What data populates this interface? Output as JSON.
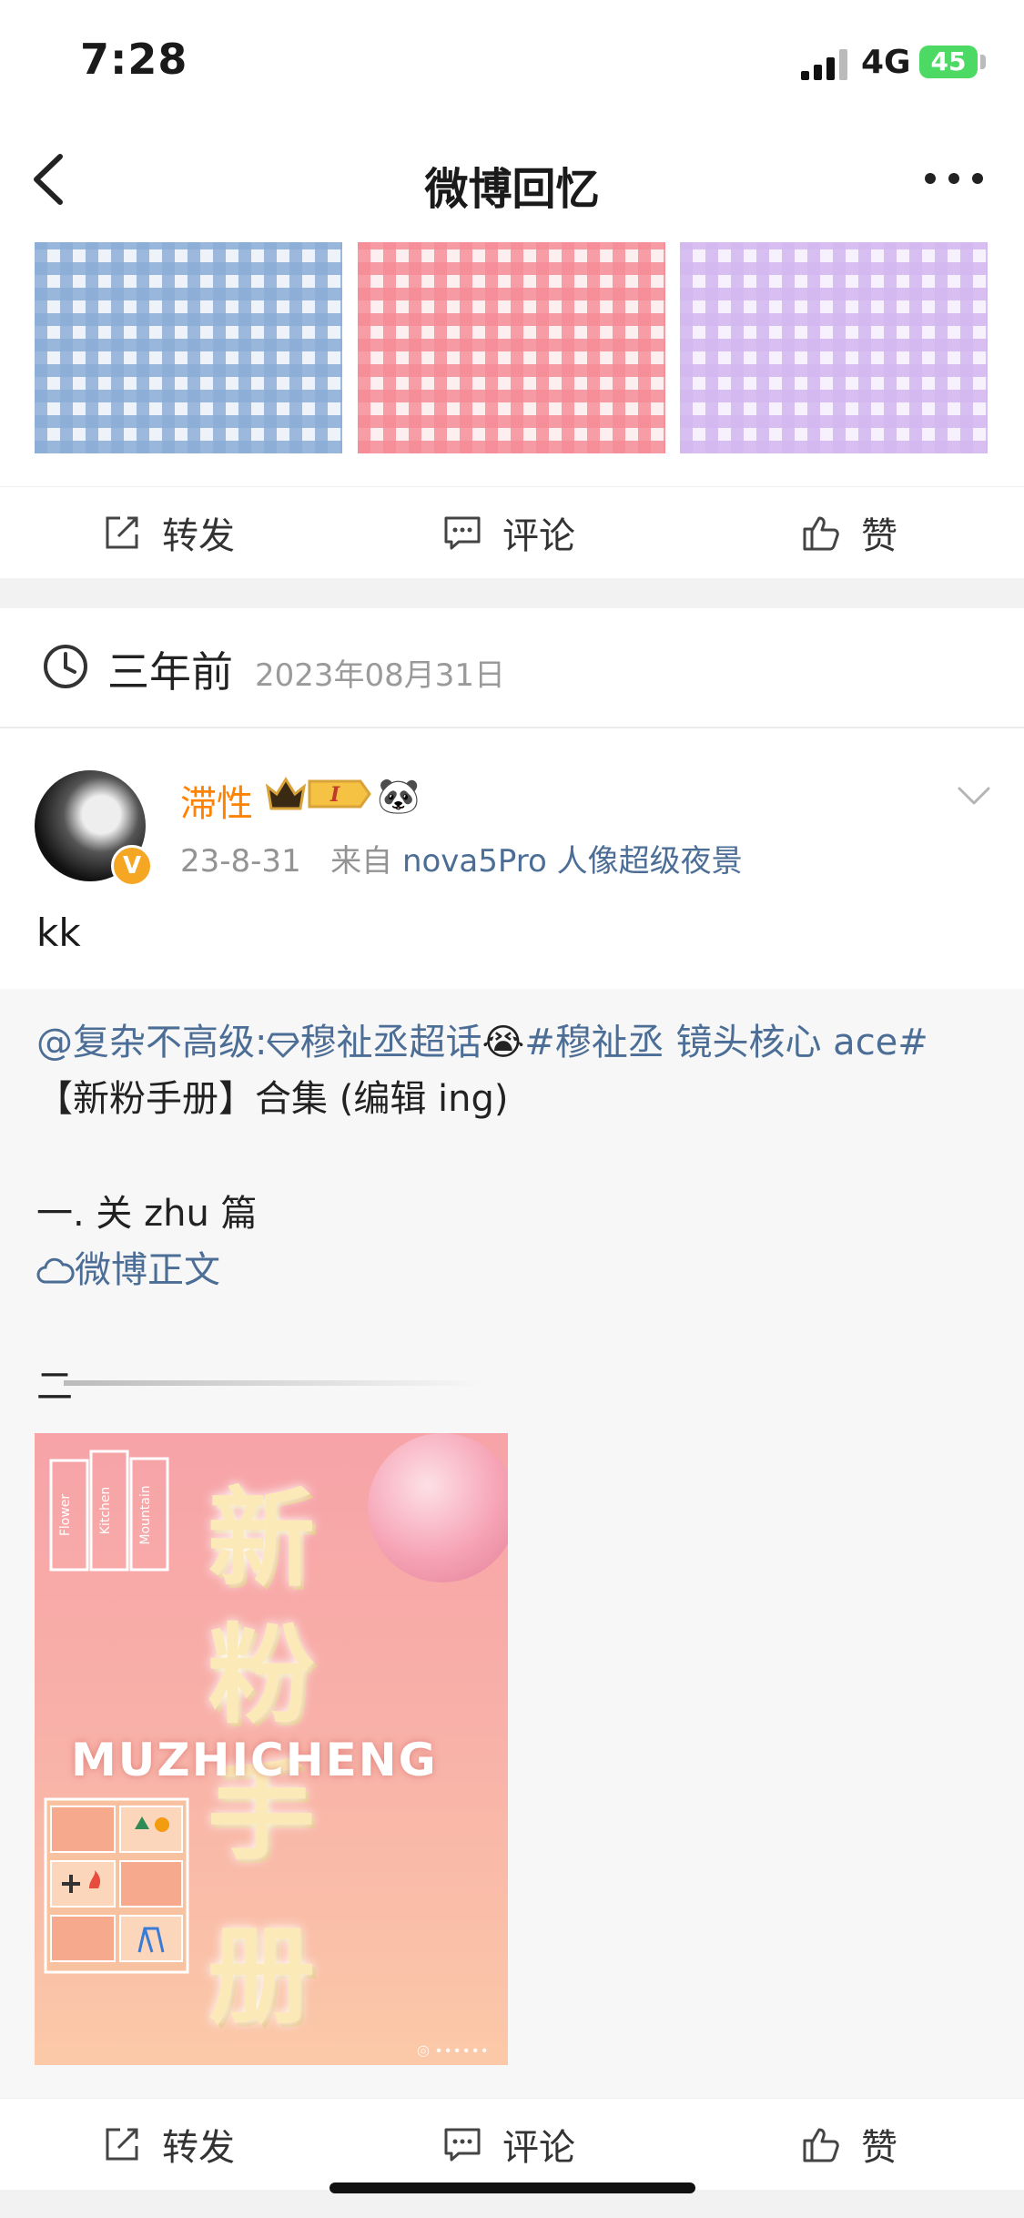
{
  "status_bar": {
    "time": "7:28",
    "network": "4G",
    "battery": "45"
  },
  "nav": {
    "title": "微博回忆"
  },
  "actions": {
    "repost": "转发",
    "comment": "评论",
    "like": "赞"
  },
  "memory": {
    "time_ago": "三年前",
    "date": "2023年08月31日"
  },
  "post": {
    "username": "滞性",
    "level_badge": "I",
    "emoji": "🐼",
    "verified_badge": "V",
    "date": "23-8-31",
    "source_prefix": "来自",
    "source": "nova5Pro 人像超级夜景",
    "text": "kk"
  },
  "repost": {
    "mention": "@复杂不高级:",
    "supertopic": "穆祉丞超话",
    "supertopic_emoji": "😭",
    "hashtag": "#穆祉丞 镜头核心 ace#",
    "line2": "【新粉手册】合集 (编辑 ing)",
    "line3": "一. 关 zhu 篇",
    "weibo_link": "微博正文",
    "line5": "二",
    "image": {
      "title_chars": [
        "新",
        "粉",
        "手",
        "册"
      ],
      "subtitle": "MUZHICHENG",
      "book_spines": [
        "Flower",
        "Kitchen",
        "Mountain"
      ]
    }
  },
  "colors": {
    "accent_orange": "#ff8200",
    "link_blue": "#4c6e96"
  }
}
